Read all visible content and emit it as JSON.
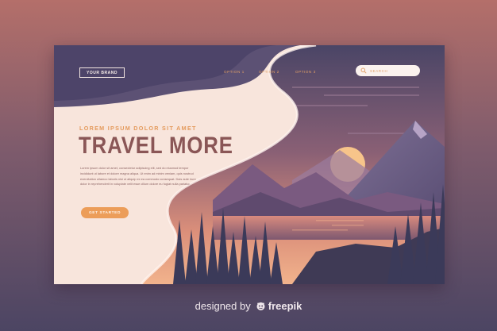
{
  "header": {
    "brand_label": "YOUR BRAND",
    "nav": [
      "OPTION 1",
      "OPTION 2",
      "OPTION 3"
    ],
    "search_placeholder": "SEARCH"
  },
  "hero": {
    "eyebrow": "LOREM IPSUM DOLOR SIT AMET",
    "headline": "TRAVEL MORE",
    "body": "Lorem ipsum dolor sit amet, consectetur adipiscing elit, sed do eiusmod tempor\nincididunt ut labore et dolore magna aliqua. Ut enim ad minim veniam, quis nostrud\nexercitation ullamco laboris nisi ut aliquip ex ea commodo consequat. Duis aute irure\ndolor in reprehenderit in voluptate velit esse cillum dolore eu fugiat nulla pariatur.",
    "cta_label": "GET STARTED"
  },
  "footer": {
    "credit_prefix": "designed by",
    "credit_brand": "freepik"
  },
  "colors": {
    "accent": "#ec9d59",
    "headline": "#8a5656",
    "panel": "#f8e5dc"
  },
  "icons": {
    "search": "search-icon",
    "freepik": "freepik-logo-icon"
  }
}
